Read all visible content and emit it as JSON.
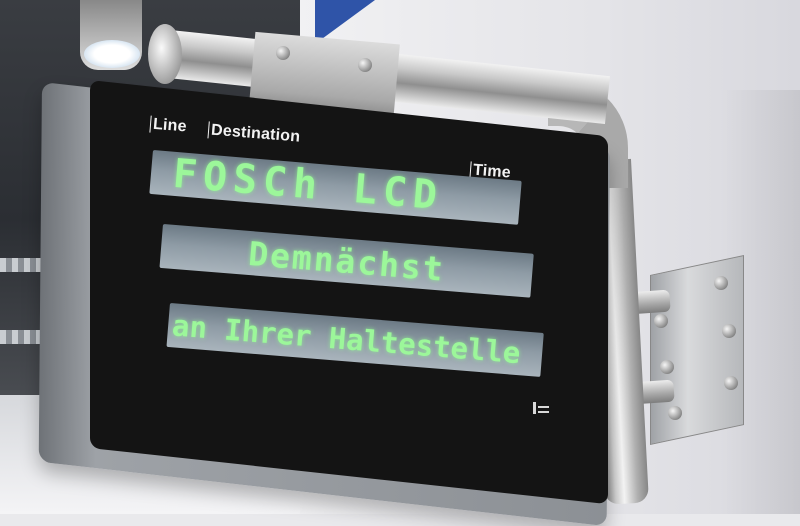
{
  "display": {
    "headers": {
      "line": "Line",
      "destination": "Destination",
      "time": "Time"
    },
    "rows": [
      {
        "text": "FOSCh LCD"
      },
      {
        "text": "Demnächst"
      },
      {
        "text": "an Ihrer Haltestelle"
      }
    ],
    "text_color": "#9cf79a",
    "lcd_color": "#8e9ba5",
    "bezel_color": "#141414"
  },
  "scene": {
    "accent_color": "#2f54a8",
    "logo": "brand-logo-icon"
  }
}
